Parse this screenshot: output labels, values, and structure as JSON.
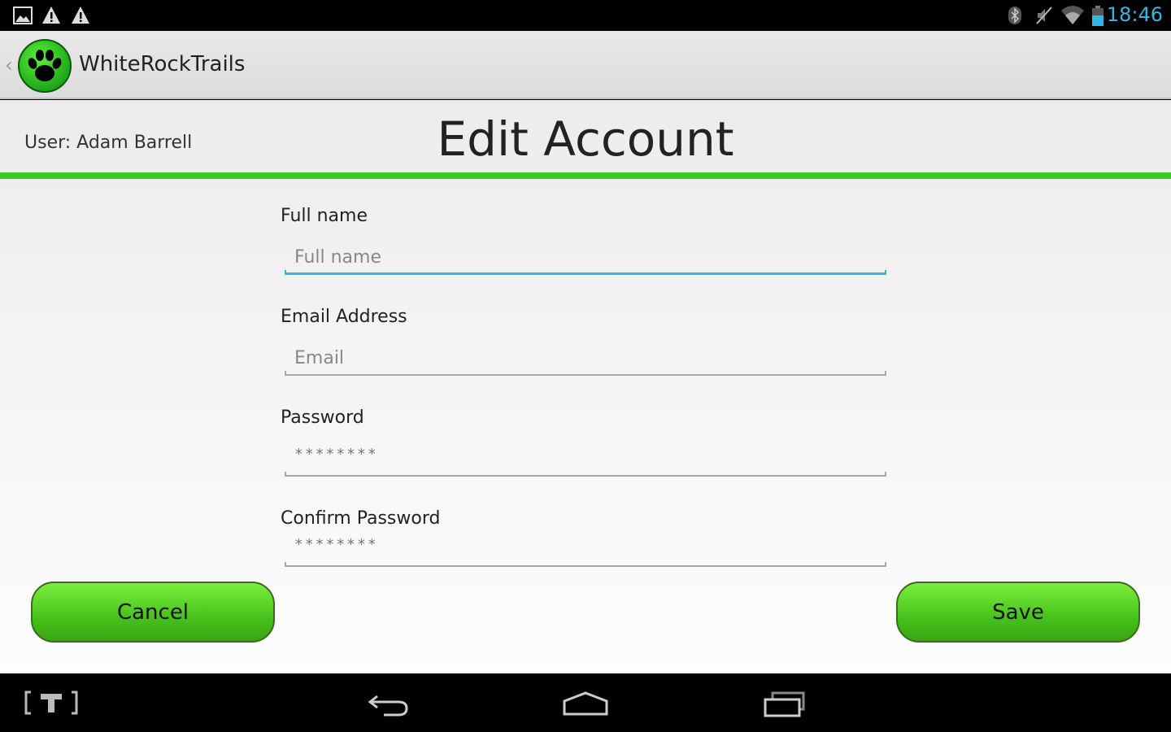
{
  "status_bar": {
    "left_icons": [
      "image-notification-icon",
      "warning-icon",
      "warning-icon"
    ],
    "right_icons": [
      "bluetooth-icon",
      "muted-icon",
      "wifi-icon",
      "battery-icon"
    ],
    "time": "18:46"
  },
  "action_bar": {
    "up_caret": "‹",
    "app_icon": "paw-icon",
    "app_title": "WhiteRockTrails"
  },
  "header": {
    "user_label": "User: Adam Barrell",
    "page_title": "Edit Account",
    "accent_color": "#3cc81e"
  },
  "form": {
    "full_name": {
      "label": "Full name",
      "placeholder": "Full name",
      "value": ""
    },
    "email": {
      "label": "Email Address",
      "placeholder": "Email",
      "value": ""
    },
    "password": {
      "label": "Password",
      "mask": "********"
    },
    "confirm_password": {
      "label": "Confirm Password",
      "mask": "********"
    }
  },
  "buttons": {
    "cancel": "Cancel",
    "save": "Save"
  },
  "nav_bar": {
    "icons": [
      "tumblr-app-icon",
      "back-icon",
      "home-icon",
      "recent-apps-icon"
    ]
  }
}
